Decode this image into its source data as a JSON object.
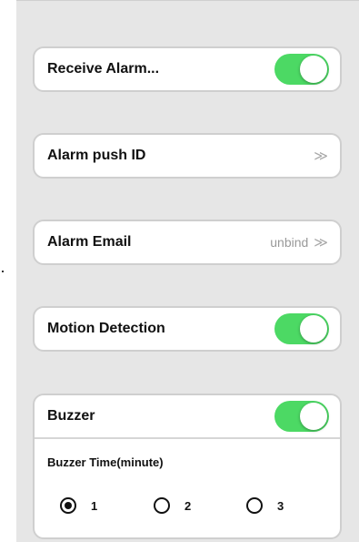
{
  "settings": {
    "receive_alarm": {
      "label": "Receive Alarm...",
      "enabled": true
    },
    "alarm_push_id": {
      "label": "Alarm push ID",
      "chevron": "≫"
    },
    "alarm_email": {
      "label": "Alarm Email",
      "value": "unbind",
      "chevron": "≫"
    },
    "motion_detection": {
      "label": "Motion Detection",
      "enabled": true
    },
    "buzzer": {
      "label": "Buzzer",
      "enabled": true,
      "time_label": "Buzzer Time(minute)",
      "options": [
        "1",
        "2",
        "3"
      ],
      "selected": "1"
    }
  },
  "colors": {
    "toggle_on": "#4cd964",
    "background": "#e6e6e6",
    "card": "#ffffff"
  }
}
